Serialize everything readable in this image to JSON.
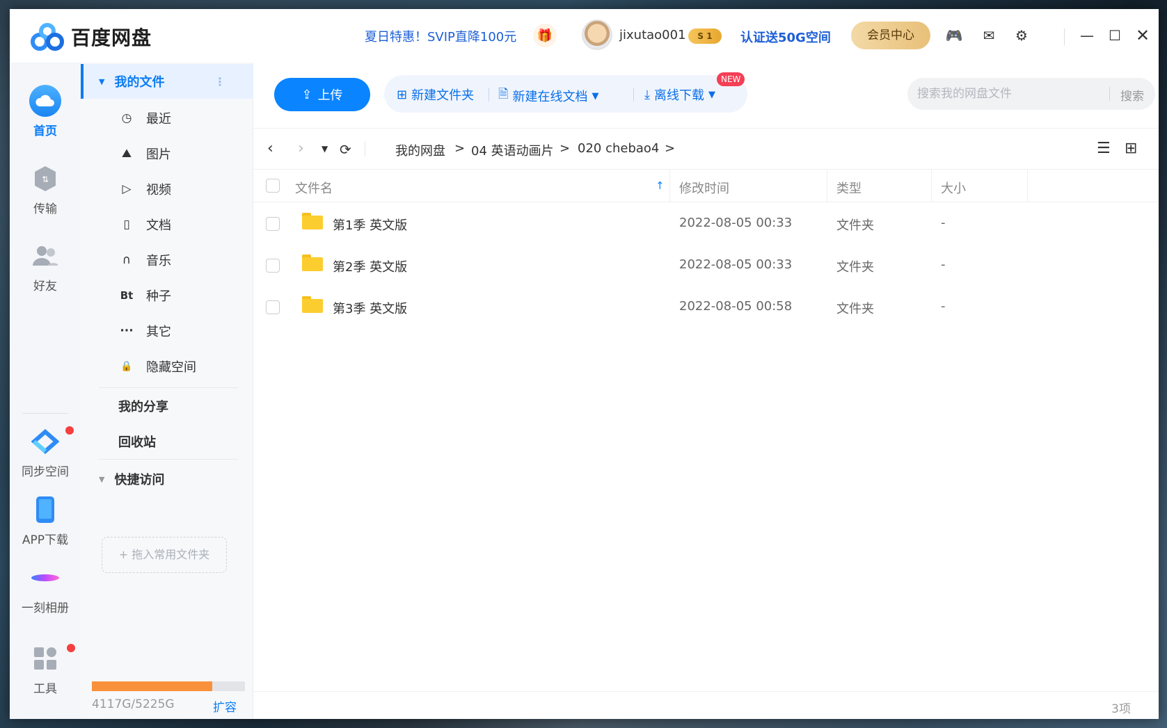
{
  "app": {
    "title": "百度网盘"
  },
  "header": {
    "promo": "夏日特惠！SVIP直降100元",
    "username": "jixutao001",
    "vip_badge": "S 1",
    "certify": "认证送50G空间",
    "member_center": "会员中心"
  },
  "rail": {
    "items": [
      {
        "label": "首页",
        "icon": "cloud-home-icon"
      },
      {
        "label": "传输",
        "icon": "transfer-icon"
      },
      {
        "label": "好友",
        "icon": "friends-icon"
      },
      {
        "label": "同步空间",
        "icon": "sync-space-icon"
      },
      {
        "label": "APP下载",
        "icon": "phone-icon"
      },
      {
        "label": "一刻相册",
        "icon": "album-icon"
      },
      {
        "label": "工具",
        "icon": "tools-icon"
      }
    ]
  },
  "nav": {
    "my_files": "我的文件",
    "items": [
      {
        "label": "最近",
        "icon": "clock-icon",
        "glyph": "◷"
      },
      {
        "label": "图片",
        "icon": "image-icon",
        "glyph": "⛰"
      },
      {
        "label": "视频",
        "icon": "video-icon",
        "glyph": "▷"
      },
      {
        "label": "文档",
        "icon": "document-icon",
        "glyph": "▯"
      },
      {
        "label": "音乐",
        "icon": "headphones-icon",
        "glyph": "∩"
      },
      {
        "label": "种子",
        "icon": "bt-icon",
        "glyph": "Bt"
      },
      {
        "label": "其它",
        "icon": "more-icon",
        "glyph": "···"
      },
      {
        "label": "隐藏空间",
        "icon": "lock-icon",
        "glyph": "🔒"
      }
    ],
    "my_share": "我的分享",
    "recycle_bin": "回收站",
    "quick_access": "快捷访问",
    "drop_hint": "+ 拖入常用文件夹",
    "storage_text": "4117G/5225G",
    "storage_used": 4117,
    "storage_total": 5225,
    "expand": "扩容"
  },
  "toolbar": {
    "upload": "上传",
    "new_folder": "新建文件夹",
    "new_online_doc": "新建在线文档",
    "new_badge": "NEW",
    "offline_download": "离线下载",
    "search_placeholder": "搜索我的网盘文件",
    "search_button": "搜索"
  },
  "breadcrumb": {
    "items": [
      "我的网盘",
      "04 英语动画片",
      "020 chebao4"
    ],
    "separator": ">"
  },
  "table": {
    "columns": {
      "name": "文件名",
      "modified": "修改时间",
      "type": "类型",
      "size": "大小"
    },
    "rows": [
      {
        "name": "第1季 英文版",
        "modified": "2022-08-05 00:33",
        "type": "文件夹",
        "size": "-"
      },
      {
        "name": "第2季 英文版",
        "modified": "2022-08-05 00:33",
        "type": "文件夹",
        "size": "-"
      },
      {
        "name": "第3季 英文版",
        "modified": "2022-08-05 00:58",
        "type": "文件夹",
        "size": "-"
      }
    ]
  },
  "status": {
    "count": "3项"
  },
  "colors": {
    "accent": "#0a84ff",
    "storage": "#f9913a",
    "folder": "#fccd2e"
  }
}
